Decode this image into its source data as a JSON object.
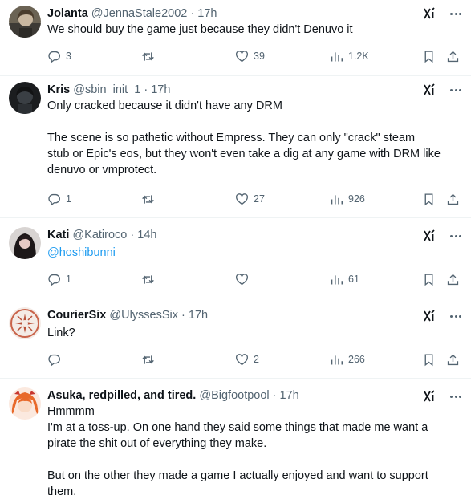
{
  "colors": {
    "text": "#0f1419",
    "secondary": "#536471",
    "mention": "#1d9bf0",
    "divider": "#eff3f4"
  },
  "icons": {
    "reply": "reply-icon",
    "repost": "repost-icon",
    "like": "heart-icon",
    "views": "views-chart-icon",
    "bookmark": "bookmark-icon",
    "share": "share-icon",
    "grok": "grok-icon",
    "more": "more-icon"
  },
  "tweets": [
    {
      "name": "Jolanta",
      "handle": "@JennaStale2002",
      "time": "17h",
      "lines": [
        "We should buy the game just because they didn't Denuvo it"
      ],
      "replies": "3",
      "reposts": "",
      "likes": "39",
      "views": "1.2K"
    },
    {
      "name": "Kris",
      "handle": "@sbin_init_1",
      "time": "17h",
      "lines": [
        "Only cracked because it didn't have any DRM",
        "",
        "The scene is so pathetic without Empress. They can only \"crack\" steam",
        "stub or Epic's eos, but they won't even take a dig at any game with DRM like",
        "denuvo or vmprotect."
      ],
      "replies": "1",
      "reposts": "",
      "likes": "27",
      "views": "926"
    },
    {
      "name": "Kati",
      "handle": "@Katiroco",
      "time": "14h",
      "mention": "@hoshibunni",
      "replies": "1",
      "reposts": "",
      "likes": "",
      "views": "61"
    },
    {
      "name": "CourierSix",
      "handle": "@UlyssesSix",
      "time": "17h",
      "lines": [
        "Link?"
      ],
      "replies": "",
      "reposts": "",
      "likes": "2",
      "views": "266"
    },
    {
      "name": "Asuka, redpilled, and tired.",
      "handle": "@Bigfootpool",
      "time": "17h",
      "lines": [
        "Hmmmm",
        "I'm at a toss-up. On one hand they said some things that made me want a",
        "pirate the shit out of everything they make.",
        "",
        "But on the other they made a game I actually enjoyed and want to support",
        "them."
      ]
    }
  ]
}
